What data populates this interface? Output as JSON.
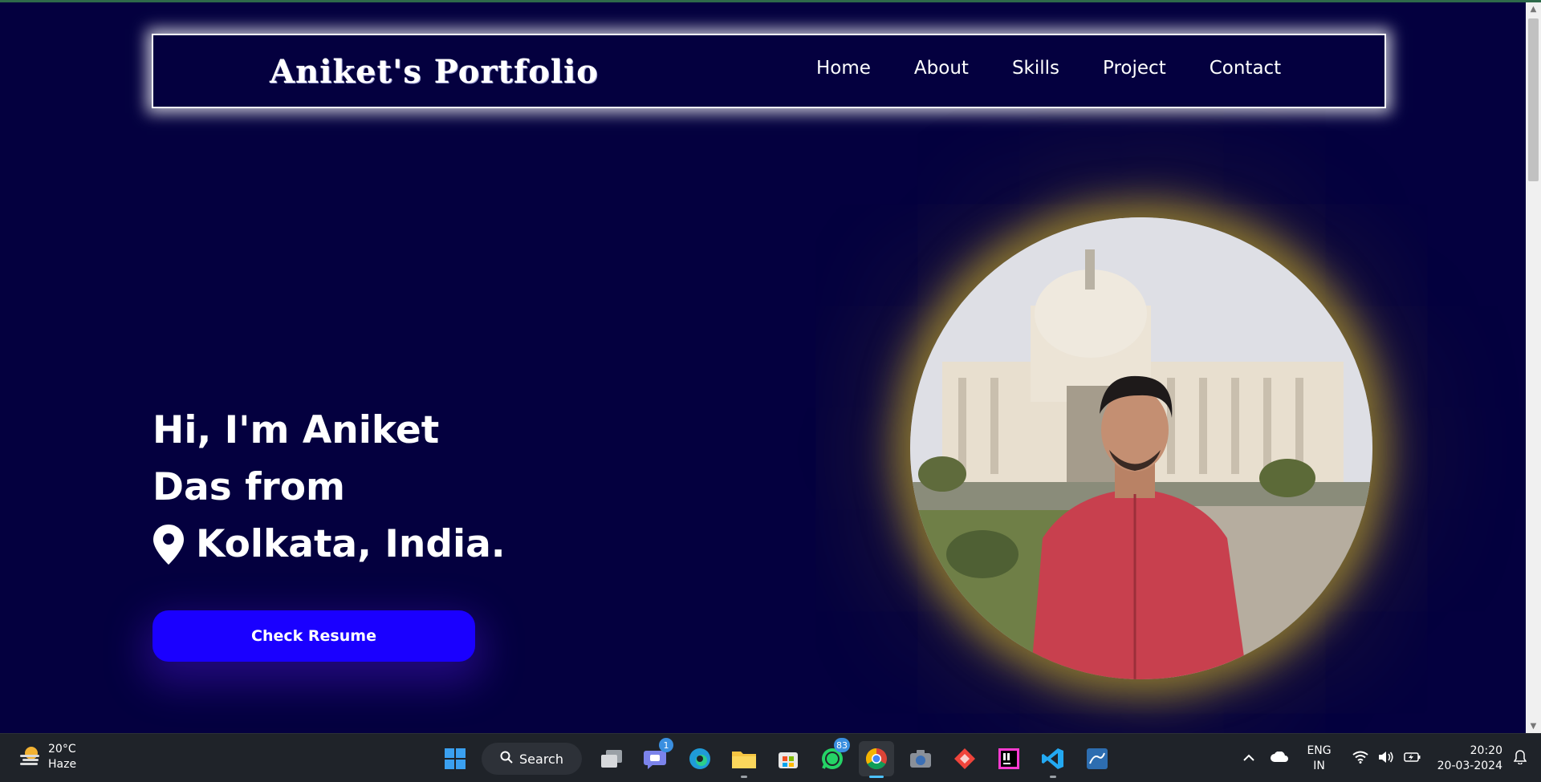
{
  "nav": {
    "brand": "Aniket's Portfolio",
    "links": [
      "Home",
      "About",
      "Skills",
      "Project",
      "Contact"
    ]
  },
  "hero": {
    "line1": "Hi, I'm Aniket",
    "line2": "Das from",
    "location": "Kolkata, India.",
    "resume_button": "Check Resume"
  },
  "taskbar": {
    "weather_temp": "20°C",
    "weather_desc": "Haze",
    "search_label": "Search",
    "teams_badge": "1",
    "whatsapp_badge": "83",
    "lang_top": "ENG",
    "lang_bottom": "IN",
    "time": "20:20",
    "date": "20-03-2024"
  },
  "colors": {
    "page_bg": "#04003f",
    "button": "#1a00ff",
    "photo_glow": "#dcbe28",
    "taskbar_bg": "#1f2329"
  }
}
